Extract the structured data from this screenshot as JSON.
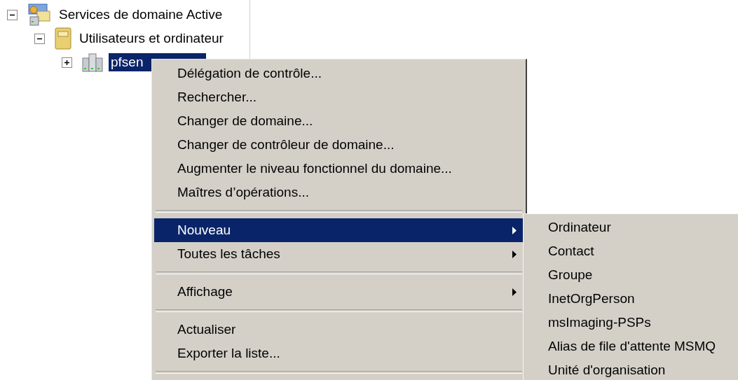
{
  "tree": [
    {
      "label": "Services de domaine Active",
      "kind": "directory",
      "expanded": true,
      "selected": false,
      "children": [
        {
          "label": "Utilisateurs et ordinateur",
          "kind": "container",
          "expanded": true,
          "selected": false,
          "children": [
            {
              "label": "pfsen",
              "kind": "domain",
              "expanded": false,
              "selected": true
            }
          ]
        }
      ]
    }
  ],
  "context_menu": {
    "items": [
      {
        "kind": "item",
        "label": "Délégation de contrôle...",
        "selected": false,
        "submenu": false
      },
      {
        "kind": "item",
        "label": "Rechercher...",
        "selected": false,
        "submenu": false
      },
      {
        "kind": "item",
        "label": "Changer de domaine...",
        "selected": false,
        "submenu": false
      },
      {
        "kind": "item",
        "label": "Changer de contrôleur de domaine...",
        "selected": false,
        "submenu": false
      },
      {
        "kind": "item",
        "label": "Augmenter le niveau fonctionnel du domaine...",
        "selected": false,
        "submenu": false
      },
      {
        "kind": "item",
        "label": "Maîtres d’opérations...",
        "selected": false,
        "submenu": false
      },
      {
        "kind": "separator"
      },
      {
        "kind": "item",
        "label": "Nouveau",
        "selected": true,
        "submenu": true
      },
      {
        "kind": "item",
        "label": "Toutes les tâches",
        "selected": false,
        "submenu": true
      },
      {
        "kind": "separator"
      },
      {
        "kind": "item",
        "label": "Affichage",
        "selected": false,
        "submenu": true
      },
      {
        "kind": "separator"
      },
      {
        "kind": "item",
        "label": "Actualiser",
        "selected": false,
        "submenu": false
      },
      {
        "kind": "item",
        "label": "Exporter la liste...",
        "selected": false,
        "submenu": false
      },
      {
        "kind": "separator"
      }
    ]
  },
  "submenu": {
    "items": [
      {
        "label": "Ordinateur",
        "selected": false
      },
      {
        "label": "Contact",
        "selected": false
      },
      {
        "label": "Groupe",
        "selected": false
      },
      {
        "label": "InetOrgPerson",
        "selected": false
      },
      {
        "label": "msImaging-PSPs",
        "selected": false
      },
      {
        "label": "Alias de file d'attente MSMQ",
        "selected": false
      },
      {
        "label": "Unité d'organisation",
        "selected": false
      }
    ]
  }
}
